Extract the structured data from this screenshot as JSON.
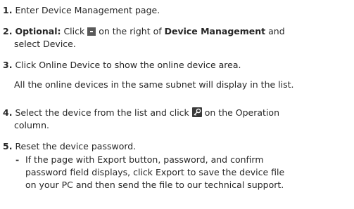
{
  "steps": [
    {
      "number": "1.",
      "text": "Enter Device Management page."
    },
    {
      "number": "2.",
      "optional_label": "Optional:",
      "text_a": " Click ",
      "icon": "dropdown-square-icon",
      "text_b": " on the right of ",
      "bold_term": "Device Management",
      "text_c": " and",
      "line2": "select Device."
    },
    {
      "number": "3.",
      "text": "Click Online Device to show the online device area.",
      "note": "All the online devices in the same subnet will display in the list."
    },
    {
      "number": "4.",
      "text_a": "Select the device from the list and click ",
      "icon": "key-edit-icon",
      "text_b": " on the Operation",
      "line2": "column."
    },
    {
      "number": "5.",
      "text": "Reset the device password.",
      "bullet_dash": "-",
      "bullet_lines": [
        "If the page with Export button, password, and confirm",
        "password field displays, click Export to save the device file",
        "on your PC and then send the file to our technical support."
      ]
    }
  ]
}
